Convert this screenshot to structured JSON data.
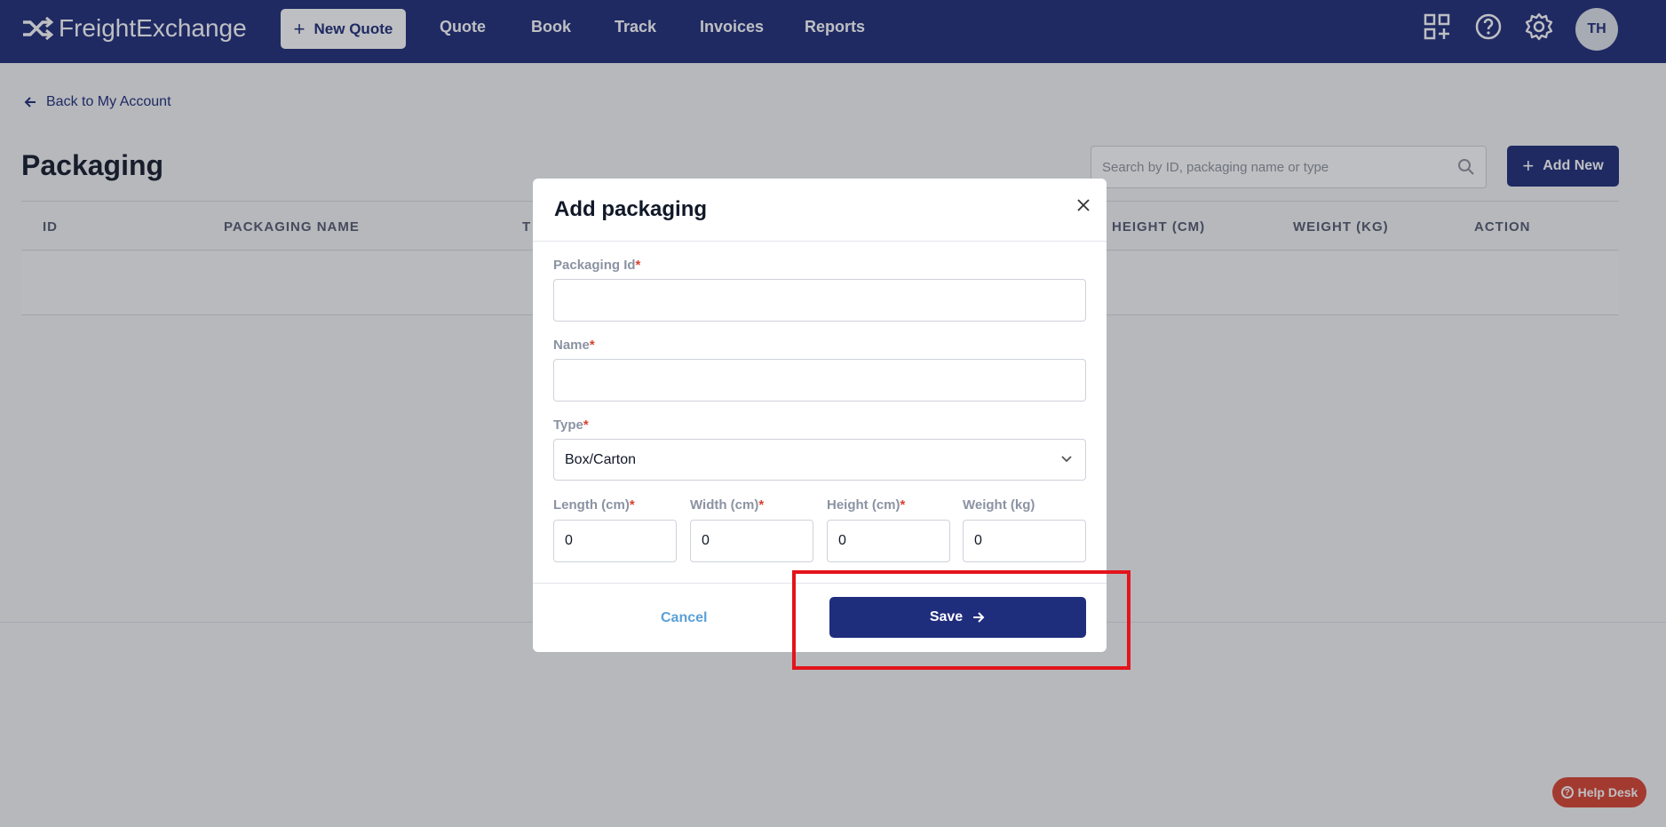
{
  "app": {
    "name": "FreightExchange"
  },
  "nav": {
    "new_quote": "New Quote",
    "items": [
      "Quote",
      "Book",
      "Track",
      "Invoices",
      "Reports"
    ],
    "avatar_initials": "TH",
    "icons": [
      "apps-add-icon",
      "help-circle-icon",
      "gear-icon"
    ]
  },
  "page": {
    "back_link": "Back to My Account",
    "title": "Packaging",
    "search_placeholder": "Search by ID, packaging name or type",
    "add_new": "Add New"
  },
  "table": {
    "columns": [
      "ID",
      "PACKAGING NAME",
      "T",
      "HEIGHT (CM)",
      "WEIGHT (KG)",
      "ACTION"
    ]
  },
  "modal": {
    "title": "Add packaging",
    "fields": {
      "packaging_id": {
        "label": "Packaging Id",
        "required": "*",
        "value": ""
      },
      "name": {
        "label": "Name",
        "required": "*",
        "value": ""
      },
      "type": {
        "label": "Type",
        "required": "*",
        "value": "Box/Carton"
      },
      "length": {
        "label": "Length (cm)",
        "required": "*",
        "value": "0"
      },
      "width": {
        "label": "Width (cm)",
        "required": "*",
        "value": "0"
      },
      "height": {
        "label": "Height (cm)",
        "required": "*",
        "value": "0"
      },
      "weight": {
        "label": "Weight (kg)",
        "value": "0"
      }
    },
    "cancel": "Cancel",
    "save": "Save"
  },
  "help_desk": "Help Desk",
  "colors": {
    "nav_bg": "#1c2a78",
    "primary": "#1f2d7d",
    "required": "#d9412e",
    "highlight": "#e3141b",
    "help": "#d9412e"
  }
}
